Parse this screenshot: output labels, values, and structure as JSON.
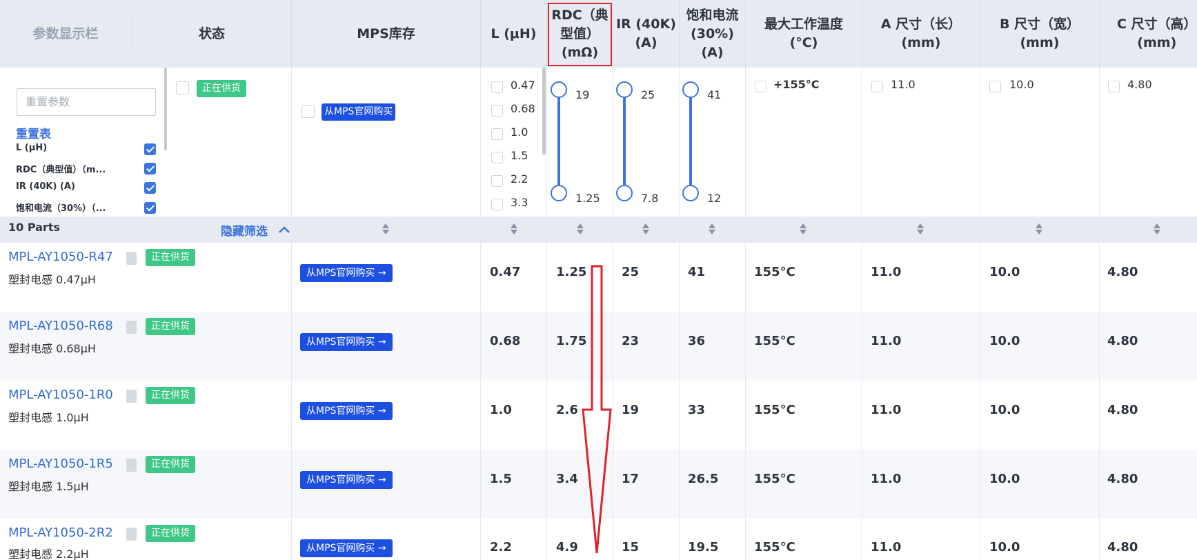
{
  "header": {
    "param_col": "参数显示栏",
    "status_col": "状态",
    "stock_col": "MPS库存",
    "cols": [
      "L (μH)",
      "RDC（典\n型值）\n(mΩ)",
      "IR (40K)\n(A)",
      "饱和电流\n(30%)\n(A)",
      "最大工作温度\n(°C)",
      "A 尺寸（长）\n(mm)",
      "B 尺寸（宽）\n(mm)",
      "C 尺寸（高）\n(mm)"
    ]
  },
  "panel": {
    "reset_placeholder": "重置参数",
    "reset_table": "重置表",
    "items": [
      "L (μH)",
      "RDC（典型值）（m...",
      "IR (40K) (A)",
      "饱和电流（30%）（..."
    ]
  },
  "filters": {
    "status": "正在供货",
    "stock": "从MPS官网购买",
    "l_options": [
      "0.47",
      "0.68",
      "1.0",
      "1.5",
      "2.2",
      "3.3"
    ],
    "rdc": {
      "max": "19",
      "min": "1.25"
    },
    "ir": {
      "max": "25",
      "min": "7.8"
    },
    "sat": {
      "max": "41",
      "min": "12"
    },
    "temp": "+155°C",
    "a": "11.0",
    "b": "10.0",
    "c": "4.80"
  },
  "parts_count": "10 Parts",
  "hide_filter": "隐藏筛选",
  "rows": [
    {
      "part": "MPL-AY1050-R47",
      "desc": "塑封电感 0.47μH",
      "status": "正在供货",
      "buy": "从MPS官网购买 →",
      "vals": [
        "0.47",
        "1.25",
        "25",
        "41",
        "155°C",
        "11.0",
        "10.0",
        "4.80"
      ]
    },
    {
      "part": "MPL-AY1050-R68",
      "desc": "塑封电感 0.68μH",
      "status": "正在供货",
      "buy": "从MPS官网购买 →",
      "vals": [
        "0.68",
        "1.75",
        "23",
        "36",
        "155°C",
        "11.0",
        "10.0",
        "4.80"
      ]
    },
    {
      "part": "MPL-AY1050-1R0",
      "desc": "塑封电感 1.0μH",
      "status": "正在供货",
      "buy": "从MPS官网购买 →",
      "vals": [
        "1.0",
        "2.6",
        "19",
        "33",
        "155°C",
        "11.0",
        "10.0",
        "4.80"
      ]
    },
    {
      "part": "MPL-AY1050-1R5",
      "desc": "塑封电感 1.5μH",
      "status": "正在供货",
      "buy": "从MPS官网购买 →",
      "vals": [
        "1.5",
        "3.4",
        "17",
        "26.5",
        "155°C",
        "11.0",
        "10.0",
        "4.80"
      ]
    },
    {
      "part": "MPL-AY1050-2R2",
      "desc": "塑封电感 2.2μH",
      "status": "正在供货",
      "buy": "从MPS官网购买 →",
      "vals": [
        "2.2",
        "4.9",
        "15",
        "19.5",
        "155°C",
        "11.0",
        "10.0",
        "4.80"
      ]
    }
  ],
  "colors": {
    "accent": "#3b73e0",
    "badge": "#3ec786",
    "buy": "#1d4fe0",
    "annotation": "#e0222a"
  }
}
